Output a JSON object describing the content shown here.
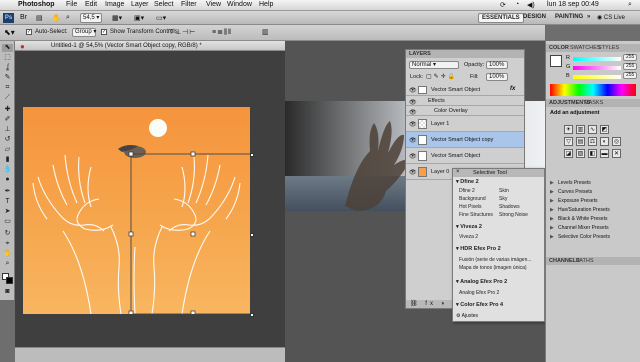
{
  "menubar": {
    "app_name": "Photoshop",
    "items": [
      "File",
      "Edit",
      "Image",
      "Layer",
      "Select",
      "Filter",
      "View",
      "Window",
      "Help"
    ],
    "status_icons": [
      "sync-icon",
      "wifi-icon",
      "volume-icon"
    ],
    "date_time": "lun 18 sep  00:49",
    "spotlight_icon": "search-icon"
  },
  "app_bar": {
    "ps_logo": "Ps",
    "zoom": "54,5",
    "workspaces": [
      "ESSENTIALS",
      "DESIGN",
      "PAINTING"
    ],
    "more": "»",
    "cs_live": "CS Live"
  },
  "options_bar": {
    "auto_select_label": "Auto-Select:",
    "auto_select_value": "Group",
    "show_transform_label": "Show Transform Controls"
  },
  "document": {
    "tab_title": "Untitled-1 @ 54,5% (Vector Smart Object copy, RGB/8) *"
  },
  "layers_panel": {
    "tab": "LAYERS",
    "blend_mode": "Normal",
    "opacity_label": "Opacity:",
    "opacity_value": "100%",
    "lock_label": "Lock:",
    "fill_label": "Fill:",
    "fill_value": "100%",
    "layers": [
      {
        "name": "Vector Smart Object",
        "fx": "fx",
        "selected": false
      },
      {
        "name": "Effects",
        "fx": "",
        "selected": false
      },
      {
        "name": "Color Overlay",
        "fx": "",
        "selected": false
      },
      {
        "name": "Layer 1",
        "fx": "",
        "selected": false
      },
      {
        "name": "Vector Smart Object copy",
        "fx": "",
        "selected": true
      },
      {
        "name": "Vector Smart Object",
        "fx": "",
        "selected": false
      },
      {
        "name": "Layer 0",
        "fx": "",
        "selected": false
      }
    ]
  },
  "filter_panel": {
    "title": "Selective Tool",
    "sections": [
      {
        "name": "Dfine 2",
        "items": [
          "Dfine 2",
          "Skin",
          "Background",
          "Sky",
          "Hot Pixels",
          "Shadows",
          "Fine Structures",
          "Strong Noise"
        ]
      },
      {
        "name": "Viveza 2",
        "items": [
          "Viveza 2"
        ]
      },
      {
        "name": "HDR Efex Pro 2",
        "items": [
          "Fusión (serie de varias imágen...",
          "Mapa de tonos (imagen única)"
        ]
      },
      {
        "name": "Analog Efex Pro 2",
        "items": [
          "Analog Efex Pro 2"
        ]
      },
      {
        "name": "Color Efex Pro 4",
        "items": []
      }
    ],
    "footer": "Ajustes"
  },
  "color_panel": {
    "tabs": [
      "COLOR",
      "SWATCHES",
      "STYLES"
    ],
    "channels": [
      {
        "label": "R",
        "value": "255"
      },
      {
        "label": "G",
        "value": "255"
      },
      {
        "label": "B",
        "value": "255"
      }
    ]
  },
  "adjustments_panel": {
    "tabs": [
      "ADJUSTMENTS",
      "MASKS"
    ],
    "heading": "Add an adjustment",
    "presets": [
      "Levels Presets",
      "Curves Presets",
      "Exposure Presets",
      "Hue/Saturation Presets",
      "Black & White Presets",
      "Channel Mixer Presets",
      "Selective Color Presets"
    ]
  },
  "bottom_tabs": [
    "CHANNELS",
    "PATHS"
  ]
}
